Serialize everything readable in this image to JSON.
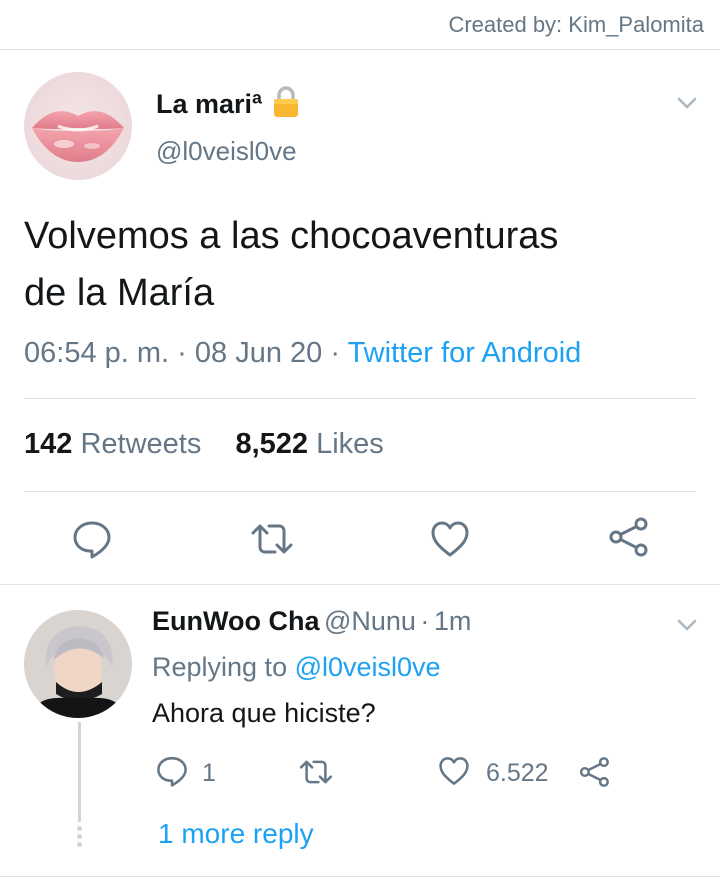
{
  "credit": "Created by: Kim_Palomita",
  "tweet": {
    "display_name": "La mariª",
    "lock_icon": "lock-icon",
    "handle": "@l0veisl0ve",
    "text_line1": "Volvemos a las chocoaventuras",
    "text_line2": "de la María",
    "time": "06:54 p. m.",
    "sep1": "·",
    "date": "08 Jun 20",
    "sep2": "·",
    "source": "Twitter for Android",
    "retweets_count": "142",
    "retweets_label": "Retweets",
    "likes_count": "8,522",
    "likes_label": "Likes",
    "actions": [
      "reply-icon",
      "retweet-icon",
      "like-icon",
      "share-icon"
    ]
  },
  "reply": {
    "display_name": "EunWoo Cha",
    "handle": "@Nunu",
    "sep": "·",
    "age": "1m",
    "replying_prefix": "Replying to",
    "replying_handle": "@l0veisl0ve",
    "text": "Ahora que hiciste?",
    "reply_count": "1",
    "like_count": "6.522",
    "more_replies": "1 more reply"
  },
  "colors": {
    "accent": "#1da1f2",
    "muted": "#657786",
    "text": "#14171a",
    "divider": "#dfe3e7"
  }
}
